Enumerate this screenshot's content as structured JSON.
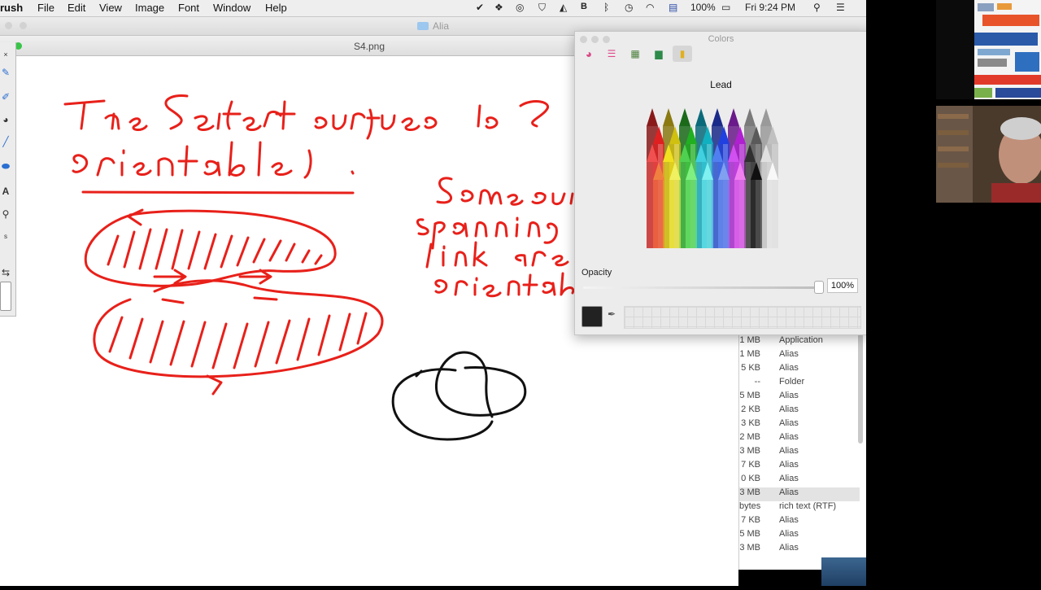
{
  "menubar": {
    "app_name": "rush",
    "items": [
      "File",
      "Edit",
      "View",
      "Image",
      "Font",
      "Window",
      "Help"
    ],
    "battery": "100%",
    "clock": "Fri 9:24 PM"
  },
  "finder": {
    "window_title": "Alia",
    "rows": [
      {
        "size": "1 MB",
        "kind": "Application"
      },
      {
        "size": "1 MB",
        "kind": "Alias"
      },
      {
        "size": "5 KB",
        "kind": "Alias"
      },
      {
        "size": "--",
        "kind": "Folder"
      },
      {
        "size": "5 MB",
        "kind": "Alias"
      },
      {
        "size": "2 KB",
        "kind": "Alias"
      },
      {
        "size": "3 KB",
        "kind": "Alias"
      },
      {
        "size": "2 MB",
        "kind": "Alias"
      },
      {
        "size": "3 MB",
        "kind": "Alias"
      },
      {
        "size": "7 KB",
        "kind": "Alias"
      },
      {
        "size": "0 KB",
        "kind": "Alias"
      },
      {
        "size": "3 MB",
        "kind": "Alias"
      },
      {
        "size": "bytes",
        "kind": "rich text (RTF)"
      },
      {
        "size": "7 KB",
        "kind": "Alias"
      },
      {
        "size": "5 MB",
        "kind": "Alias"
      },
      {
        "size": "3 MB",
        "kind": "Alias"
      }
    ],
    "selected_row": 11
  },
  "document": {
    "title": "S4.png",
    "handwriting": {
      "line1": "The Seifert surface is",
      "line2": "orientable .",
      "right1": "Some sur",
      "right2": "spanning",
      "right3": "link are",
      "right4": "orientable"
    }
  },
  "colors_panel": {
    "title": "Colors",
    "tabs": [
      "color-wheel",
      "color-sliders",
      "color-palettes",
      "image-palettes",
      "crayons"
    ],
    "selected_tab": "crayons",
    "selected_name": "Lead",
    "opacity_label": "Opacity",
    "opacity_value": "100%",
    "opacity_level": 1.0,
    "current_color": "#222222"
  },
  "colors": {
    "ink_red": "#e8201a",
    "ink_black": "#111111"
  }
}
